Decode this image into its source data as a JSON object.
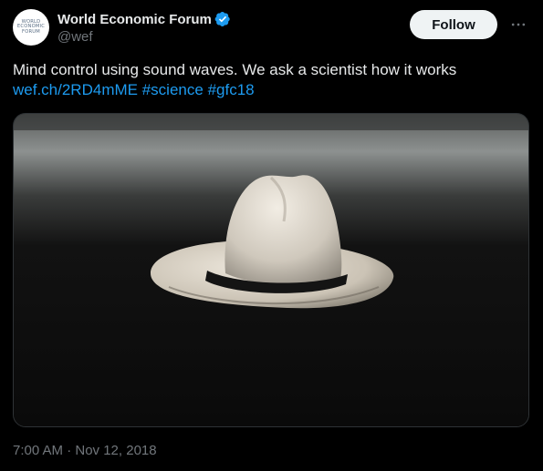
{
  "author": {
    "display_name": "World Economic Forum",
    "handle": "@wef",
    "avatar_lines": [
      "WORLD",
      "ECONOMIC",
      "FORUM"
    ],
    "verified_icon": "verified-badge-icon"
  },
  "actions": {
    "follow_label": "Follow",
    "more_icon": "more-options-icon"
  },
  "tweet": {
    "text": "Mind control using sound waves. We ask a scientist how it works",
    "link": "wef.ch/2RD4mME",
    "hashtag_1": "#science",
    "hashtag_2": "#gfc18"
  },
  "media": {
    "icon": "photo-of-white-fedora-hat"
  },
  "meta": {
    "timestamp": "7:00 AM · Nov 12, 2018"
  },
  "colors": {
    "background": "#000000",
    "text": "#e7e9ea",
    "secondary": "#71767b",
    "accent": "#1d9bf0",
    "follow_bg": "#eff3f4"
  }
}
